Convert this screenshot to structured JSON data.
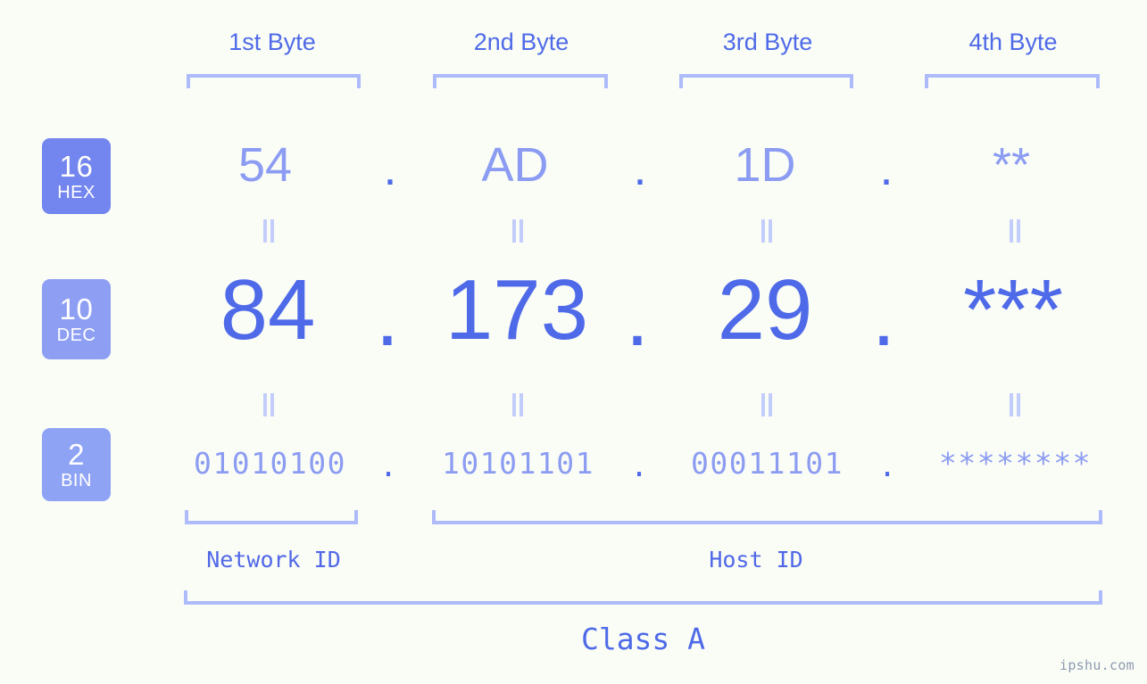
{
  "meta": {
    "background_color": "#fafdf6",
    "accent_color": "#4f6ae8",
    "muted_accent_color": "#8c9cf2",
    "bracket_color": "#aebbfb",
    "watermark": "ipshu.com"
  },
  "byte_headers": [
    {
      "label": "1st Byte"
    },
    {
      "label": "2nd Byte"
    },
    {
      "label": "3rd Byte"
    },
    {
      "label": "4th Byte"
    }
  ],
  "bases": [
    {
      "number": "16",
      "name": "HEX",
      "badge_color": "#7385ee"
    },
    {
      "number": "10",
      "name": "DEC",
      "badge_color": "#8e9ff3"
    },
    {
      "number": "2",
      "name": "BIN",
      "badge_color": "#8fa3f4"
    }
  ],
  "rows": {
    "hex": {
      "base_number": "16",
      "base_name": "HEX",
      "values": [
        "54",
        "AD",
        "1D",
        "**"
      ],
      "separator": "."
    },
    "dec": {
      "base_number": "10",
      "base_name": "DEC",
      "values": [
        "84",
        "173",
        "29",
        "***"
      ],
      "separator": "."
    },
    "bin": {
      "base_number": "2",
      "base_name": "BIN",
      "values": [
        "01010100",
        "10101101",
        "00011101",
        "********"
      ],
      "separator": "."
    }
  },
  "equality_symbol": "=",
  "segments": {
    "network_id": {
      "label": "Network ID"
    },
    "host_id": {
      "label": "Host ID"
    },
    "class": {
      "label": "Class A"
    }
  }
}
